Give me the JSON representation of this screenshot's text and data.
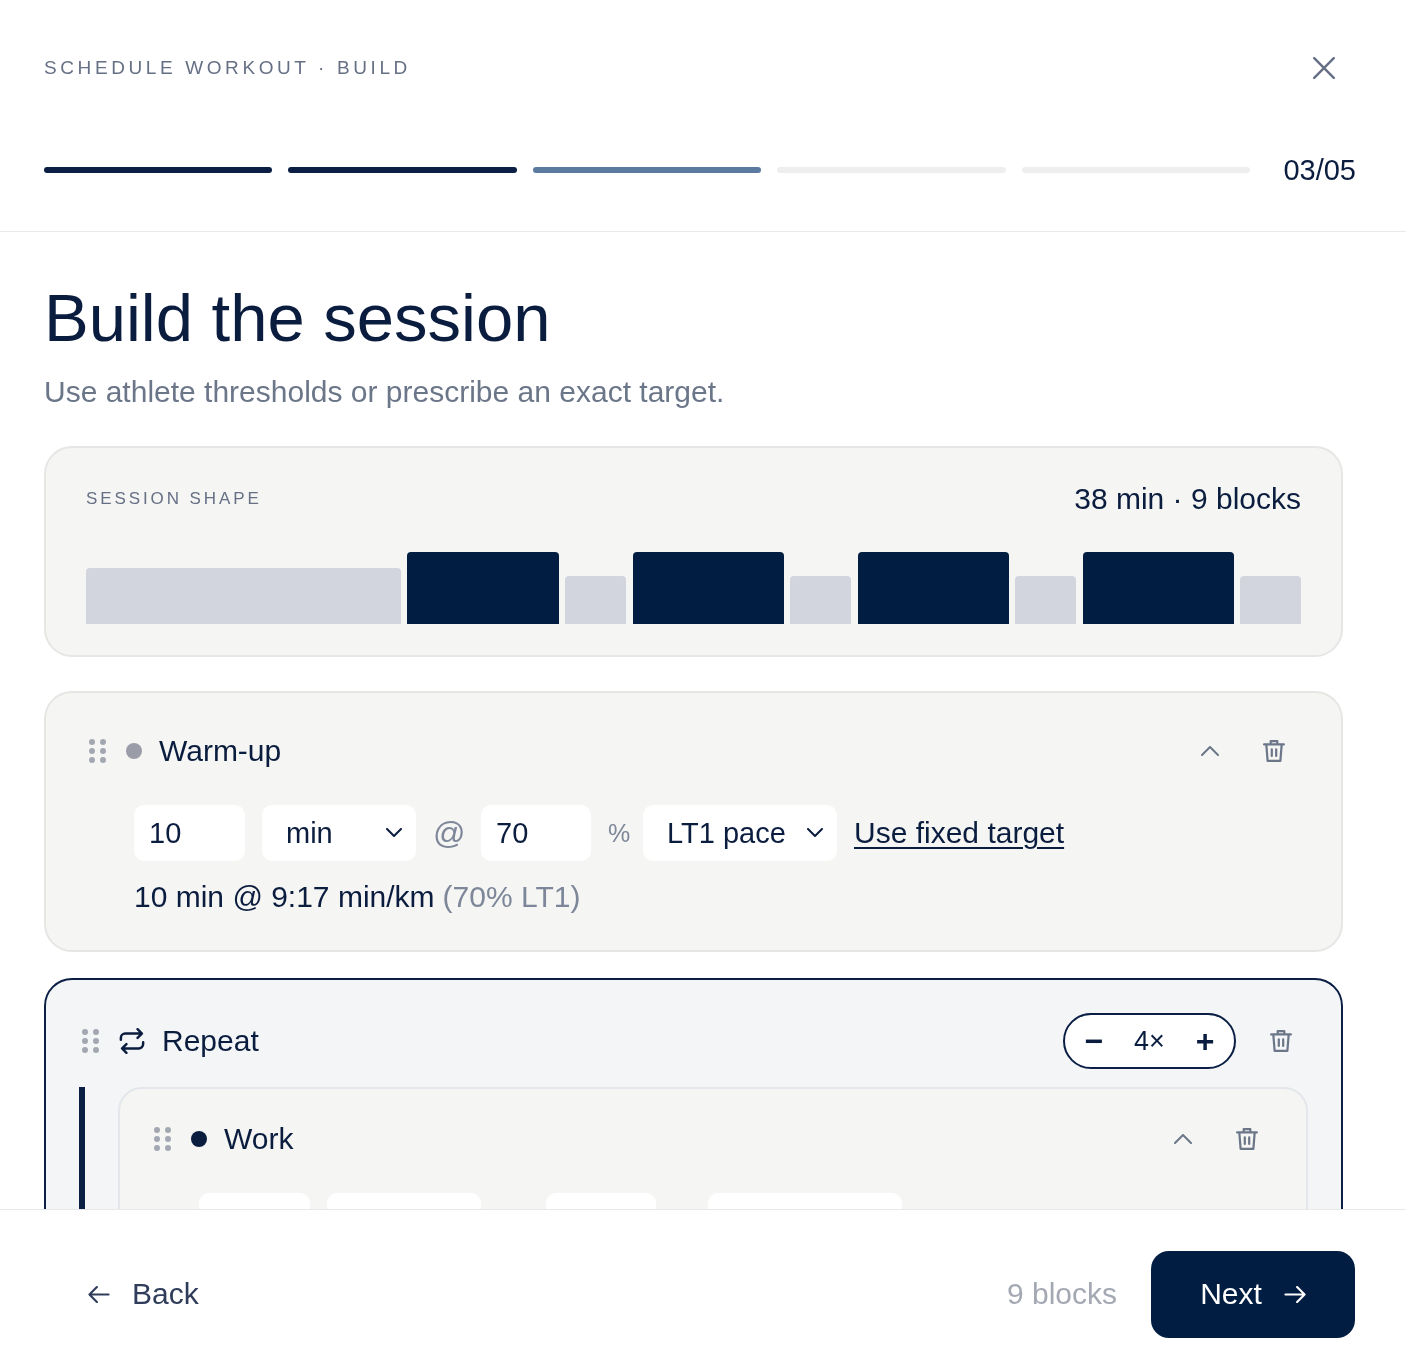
{
  "header": {
    "title": "SCHEDULE WORKOUT · BUILD",
    "steps": [
      {
        "kind": "done"
      },
      {
        "kind": "done"
      },
      {
        "kind": "current"
      },
      {
        "kind": "upcoming"
      },
      {
        "kind": "upcoming"
      }
    ],
    "step_count": "03/05"
  },
  "intro": {
    "heading": "Build the session",
    "subtitle": "Use athlete thresholds or prescribe an exact target."
  },
  "session_shape": {
    "label": "SESSION SHAPE",
    "summary": "38 min · 9 blocks",
    "bars": [
      {
        "kind": "warmup"
      },
      {
        "kind": "work"
      },
      {
        "kind": "recovery"
      },
      {
        "kind": "work"
      },
      {
        "kind": "recovery"
      },
      {
        "kind": "work"
      },
      {
        "kind": "recovery"
      },
      {
        "kind": "work"
      },
      {
        "kind": "recovery"
      }
    ]
  },
  "blocks": [
    {
      "kind": "step",
      "title": "Warm-up",
      "color": "#9a9ca8",
      "expanded": true,
      "fields": [
        {
          "kind": "number",
          "value": "10"
        },
        {
          "kind": "select",
          "value": "min"
        },
        {
          "kind": "symbol",
          "text": "@"
        },
        {
          "kind": "number",
          "value": "70"
        },
        {
          "kind": "symbol",
          "text": "%"
        },
        {
          "kind": "select",
          "value": "LT1 pace"
        },
        {
          "kind": "link",
          "text": "Use fixed target"
        }
      ],
      "summary": "10 min @ 9:17 min/km",
      "summary_note": "(70% LT1)"
    },
    {
      "kind": "repeat",
      "title": "Repeat",
      "decrement": "−",
      "count": "4×",
      "increment": "+",
      "children": [
        {
          "kind": "step",
          "title": "Work",
          "color": "#0b1d3f",
          "expanded": true,
          "fields": [
            {
              "kind": "number"
            },
            {
              "kind": "select"
            },
            {
              "kind": "symbol"
            },
            {
              "kind": "number"
            },
            {
              "kind": "symbol"
            },
            {
              "kind": "select"
            }
          ]
        }
      ]
    }
  ],
  "footer": {
    "back": "Back",
    "count": "9 blocks",
    "next": "Next"
  }
}
